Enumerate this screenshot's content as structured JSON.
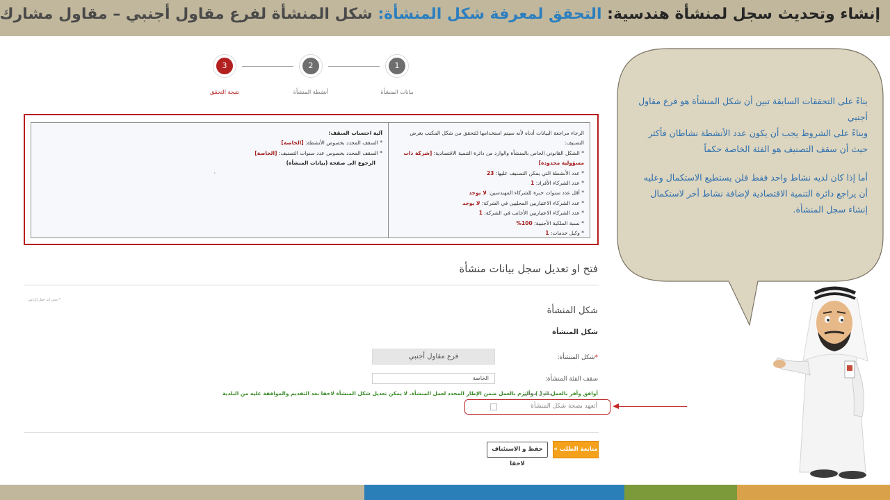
{
  "header": {
    "title_part1": "إنشاء وتحديث سجل لمنشأة هندسية:",
    "title_part2": "التحقق لمعرفة شكل المنشأة:",
    "title_part3": "شكل المنشأة لفرع مقاول أجنبي – مقاول مشارك"
  },
  "stepper": {
    "steps": [
      {
        "number": "1",
        "label": "بيانات المنشأة"
      },
      {
        "number": "2",
        "label": "أنشطة المنشأة"
      },
      {
        "number": "3",
        "label": "نتيجة التحقق"
      }
    ]
  },
  "review": {
    "right_panel": {
      "intro": "الرجاء مراجعة البيانات أدناه لأنه سيتم استخدامها للتحقق من شكل المكتب بغرض التصنيف:",
      "legal_form_label": "* الشكل القانوني الخاص بالمنشأة والوارد من دائرة التنمية الاقتصادية:",
      "legal_form_value": "[شركة ذات مسؤولية محدودة]",
      "activities_label": "* عدد الأنشطة التي يمكن التصنيف عليها:",
      "activities_value": "23",
      "individuals_label": "* عدد الشركاء الأفراد:",
      "individuals_value": "1",
      "experience_label": "* أقل عدد سنوات خبرة للشركاء المهندسين:",
      "experience_value": "لا يوجد",
      "local_partners_label": "* عدد الشركاء الاعتباريين المحليين في الشركة:",
      "local_partners_value": "لا يوجد",
      "foreign_partners_label": "* عدد الشركاء الاعتباريين الأجانب في الشركة:",
      "foreign_partners_value": "1",
      "foreign_ownership_label": "* نسبة الملكية الأجنبية:",
      "foreign_ownership_value": "100%",
      "service_agent_label": "* وكيل خدمات:",
      "service_agent_value": "1"
    },
    "left_panel": {
      "title": "آلية احتساب السقف:",
      "ceiling_activities_label": "* السقف المحدد بخصوص الأنشطة:",
      "ceiling_activities_value": "[الخاصة]",
      "ceiling_years_label": "* السقف المحدد بخصوص عدد سنوات التصنيف:",
      "ceiling_years_value": "[الخاصة]",
      "back_link": "الرجوع الى صفحة (بيانات المنشأة)",
      "dot": "·"
    }
  },
  "form": {
    "section_title": "فتح او تعديل سجل بيانات منشأة",
    "required_note": "* تعني انه حقل إلزامي",
    "sub_title": "شكل المنشأة",
    "sub_title2": "شكل المنشأة",
    "entity_form_label": "شكل المنشأة:",
    "entity_form_required": "*",
    "entity_form_value": "فرع مقاول أجنبي",
    "category_label": "سقف الفئة المنشأة:",
    "category_value": "الخاصة",
    "agreement_note": "أوافق وأقر بالعمل له (               ) وألتزم بالعمل ضمن الإطار المحدد لعمل المنشأة. لا يمكن تعديل شكل المنشأة لاحقا بعد التقديم والموافقة عليه من البلدية",
    "local_contractor_tag": "مقاول محلي",
    "pledge_label": "أتعهد بصحة شكل المنشأة"
  },
  "buttons": {
    "continue_label": "متابعة الطلب »",
    "save_label": "حفظ و الاستئناف لاحقا"
  },
  "bubble": {
    "line1": "بناءً على التحققات السابقة تبين أن شكل المنشأة هو فرع مقاول أجنبي",
    "line2": "وبناءً على الشروط يجب أن يكون عدد الأنشطة نشاطان فأكثر حيث أن سقف التصنيف هو الفئة الخاصة حكماً",
    "line3": "أما إذا كان لديه نشاط واحد فقط فلن يستطيع الاستكمال وعليه أن يراجع دائرة التنمية الاقتصادية لإضافة نشاط أخر لاستكمال إنشاء سجل المنشأة."
  },
  "colors": {
    "header_bg": "#c1b79c",
    "accent_blue": "#2d7fbf",
    "error_red": "#b71c1c",
    "button_orange": "#f5a11c",
    "note_green": "#3c8c2a",
    "footer_tan": "#c1b79c",
    "footer_blue": "#2b7fb8",
    "footer_green": "#7c9a3a",
    "footer_orange": "#d9a24a"
  }
}
